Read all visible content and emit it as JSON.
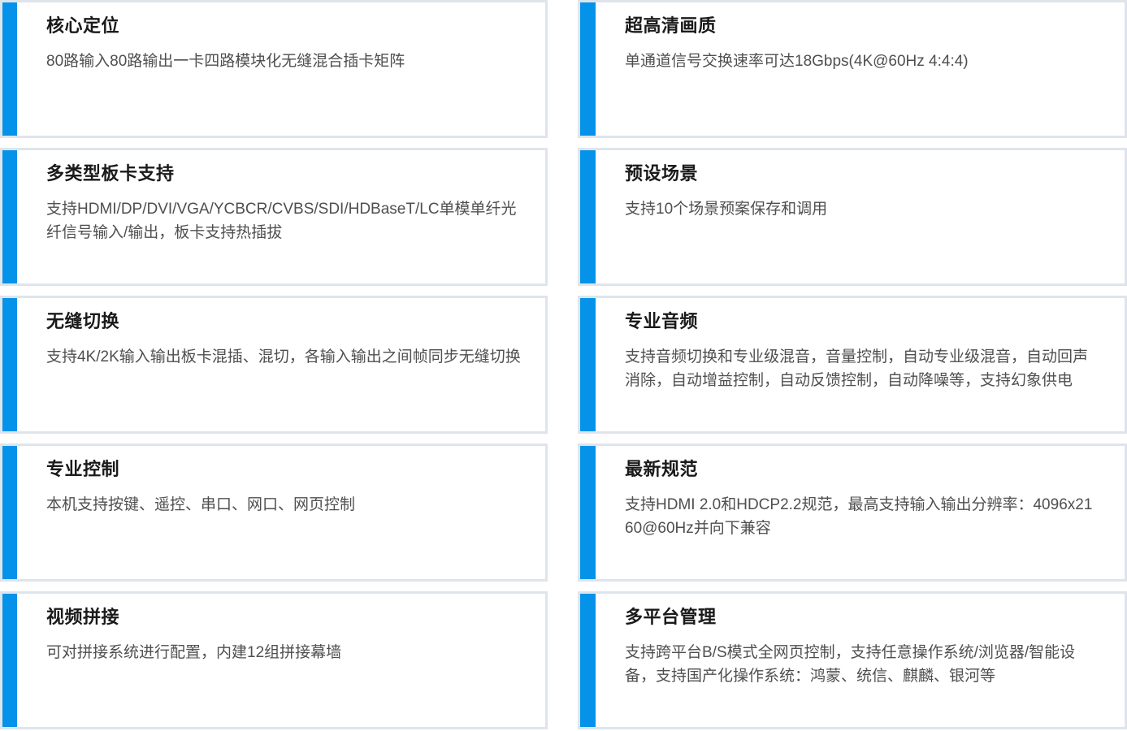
{
  "accent_color": "#0593EA",
  "border_color": "#dfe4ec",
  "cards": [
    {
      "title": "核心定位",
      "desc": "80路输入80路输出一卡四路模块化无缝混合插卡矩阵"
    },
    {
      "title": "超高清画质",
      "desc": "单通道信号交换速率可达18Gbps(4K@60Hz 4:4:4)"
    },
    {
      "title": "多类型板卡支持",
      "desc": "支持HDMI/DP/DVI/VGA/YCBCR/CVBS/SDI/HDBaseT/LC单模单纤光纤信号输入/输出，板卡支持热插拔"
    },
    {
      "title": "预设场景",
      "desc": "支持10个场景预案保存和调用"
    },
    {
      "title": "无缝切换",
      "desc": "支持4K/2K输入输出板卡混插、混切，各输入输出之间帧同步无缝切换"
    },
    {
      "title": "专业音频",
      "desc": "支持音频切换和专业级混音，音量控制，自动专业级混音，自动回声消除，自动增益控制，自动反馈控制，自动降噪等，支持幻象供电"
    },
    {
      "title": "专业控制",
      "desc": "本机支持按键、遥控、串口、网口、网页控制"
    },
    {
      "title": "最新规范",
      "desc": "支持HDMI 2.0和HDCP2.2规范，最高支持输入输出分辨率：4096x2160@60Hz并向下兼容"
    },
    {
      "title": "视频拼接",
      "desc": "可对拼接系统进行配置，内建12组拼接幕墙"
    },
    {
      "title": "多平台管理",
      "desc": "支持跨平台B/S模式全网页控制，支持任意操作系统/浏览器/智能设备，支持国产化操作系统：鸿蒙、统信、麒麟、银河等"
    }
  ]
}
